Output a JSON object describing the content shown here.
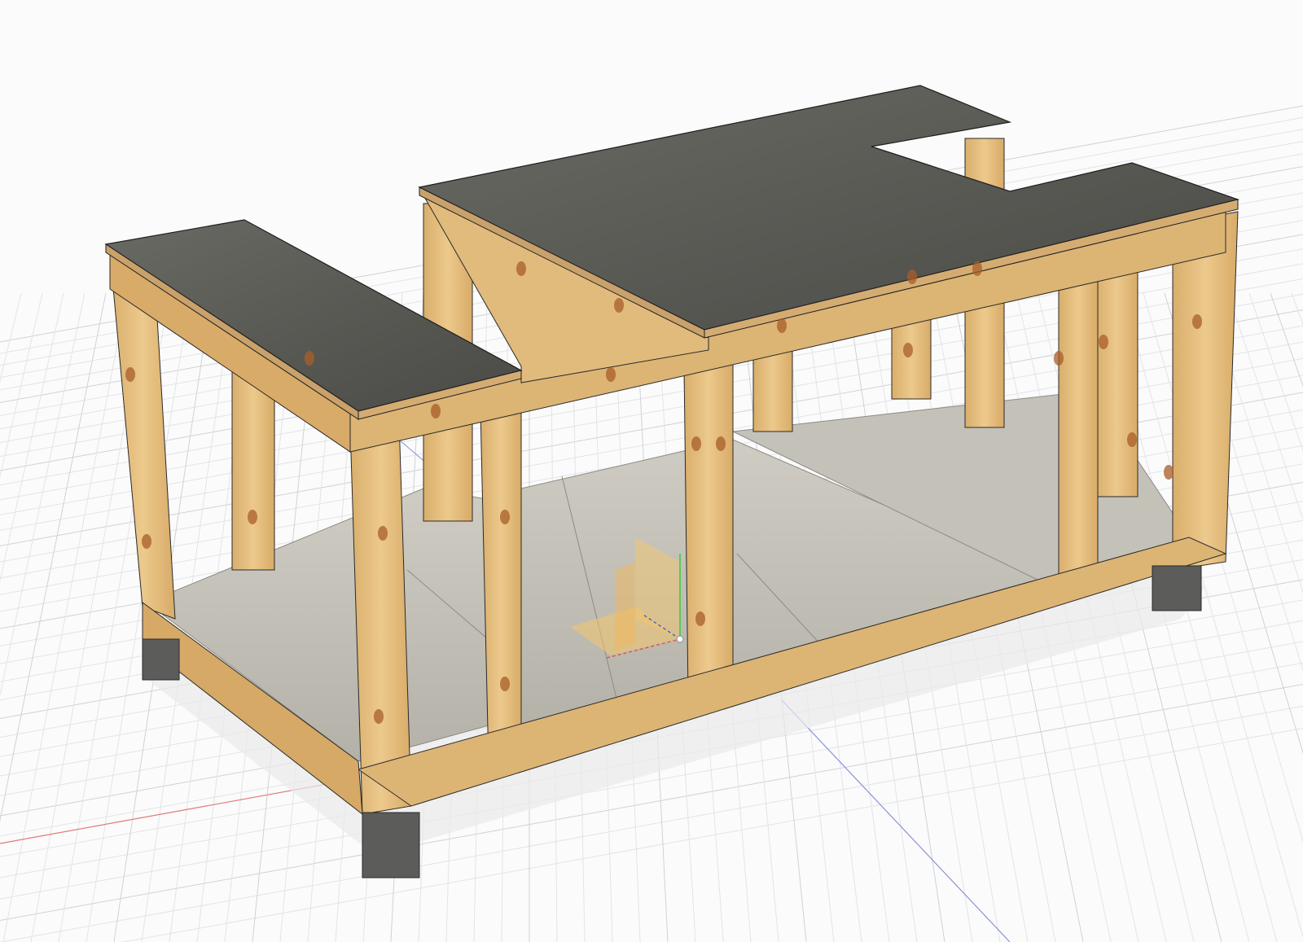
{
  "viewport": {
    "background": "#fbfbfb",
    "grid_minor_color": "#e2e4e7",
    "grid_major_color": "#cfd2d6",
    "x_axis_color": "#e07a7a",
    "z_axis_color": "#8a93d8"
  },
  "model": {
    "wood_color": "#e3bd7e",
    "wood_dark_color": "#c99a5a",
    "knot_color": "#a85e2a",
    "top_color": "#555550",
    "floor_color": "#c9c6bd",
    "foot_color": "#5c5c5a"
  },
  "origin_gizmo": {
    "plane_color": "#f3c76b",
    "x_color": "#e05555",
    "y_color": "#55cc55",
    "z_color": "#5566cc"
  }
}
